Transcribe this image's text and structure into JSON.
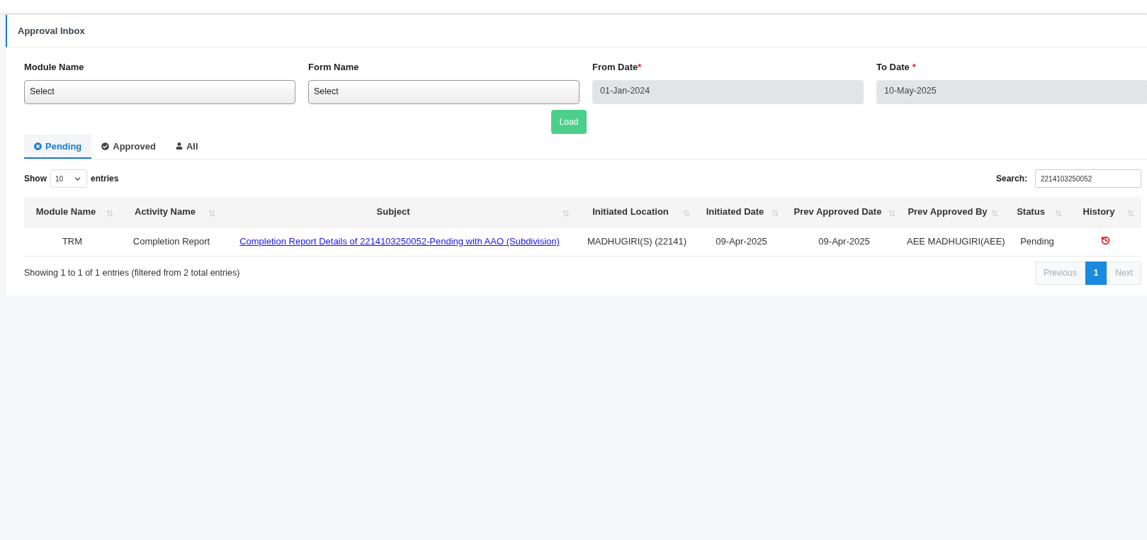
{
  "page_title": "Approval Inbox",
  "filters": [
    {
      "kind": "select",
      "label": "Module Name",
      "value": "Select"
    },
    {
      "kind": "select",
      "label": "Form Name",
      "value": "Select"
    },
    {
      "kind": "date",
      "label": "From Date",
      "required_mark": "*",
      "value": "01-Jan-2024"
    },
    {
      "kind": "date",
      "label": "To Date",
      "required_mark": "*",
      "value": "10-May-2025"
    }
  ],
  "load_button": "Load",
  "tabs": [
    {
      "label": "Pending",
      "selected": true
    },
    {
      "label": "Approved",
      "selected": false
    },
    {
      "label": "All",
      "selected": false
    }
  ],
  "length_menu": {
    "before": "Show",
    "value": "10",
    "after": "entries"
  },
  "search": {
    "label": "Search:",
    "value": "2214103250052"
  },
  "table": {
    "columns": [
      "Module Name",
      "Activity Name",
      "Subject",
      "Initiated Location",
      "Initiated Date",
      "Prev Approved Date",
      "Prev Approved By",
      "Status",
      "History"
    ],
    "rows": [
      {
        "cells": [
          "TRM",
          "Completion Report",
          "Completion Report Details of 2214103250052-Pending with AAO (Subdivision)",
          "MADHUGIRI(S) (22141)",
          "09-Apr-2025",
          "09-Apr-2025",
          "AEE MADHUGIRI(AEE)",
          "Pending"
        ]
      }
    ]
  },
  "info": "Showing 1 to 1 of 1 entries (filtered from 2 total entries)",
  "pagination": [
    {
      "label": "Previous",
      "selected": false,
      "disabled": true
    },
    {
      "label": "1",
      "selected": true,
      "disabled": false
    },
    {
      "label": "Next",
      "selected": false,
      "disabled": true
    }
  ]
}
